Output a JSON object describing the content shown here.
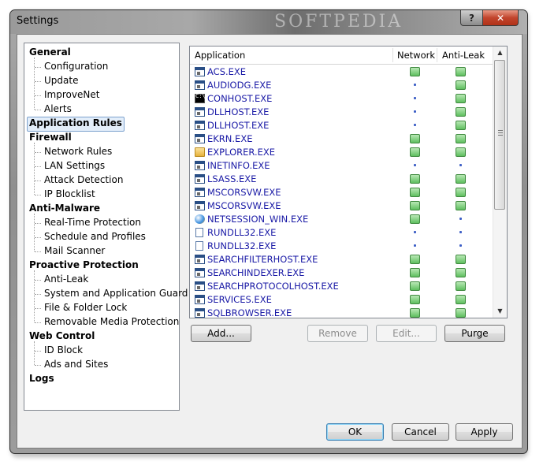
{
  "window": {
    "title": "Settings",
    "watermark": "SOFTPEDIA",
    "help_label": "?",
    "close_label": "✕"
  },
  "tree": {
    "categories": [
      {
        "label": "General",
        "children": [
          "Configuration",
          "Update",
          "ImproveNet",
          "Alerts"
        ]
      },
      {
        "label": "Application Rules",
        "selected": true,
        "children": []
      },
      {
        "label": "Firewall",
        "children": [
          "Network Rules",
          "LAN Settings",
          "Attack Detection",
          "IP Blocklist"
        ]
      },
      {
        "label": "Anti-Malware",
        "children": [
          "Real-Time Protection",
          "Schedule and Profiles",
          "Mail Scanner"
        ]
      },
      {
        "label": "Proactive Protection",
        "children": [
          "Anti-Leak",
          "System and Application Guard",
          "File & Folder Lock",
          "Removable Media Protection"
        ]
      },
      {
        "label": "Web Control",
        "children": [
          "ID Block",
          "Ads and Sites"
        ]
      },
      {
        "label": "Logs",
        "children": []
      }
    ]
  },
  "list": {
    "columns": {
      "application": "Application",
      "network": "Network",
      "antileak": "Anti-Leak"
    },
    "rows": [
      {
        "name": "ACS.EXE",
        "icon": "window-icon",
        "network": true,
        "antileak": true
      },
      {
        "name": "AUDIODG.EXE",
        "icon": "window-icon",
        "network": false,
        "antileak": true
      },
      {
        "name": "CONHOST.EXE",
        "icon": "cmd-icon",
        "network": false,
        "antileak": true
      },
      {
        "name": "DLLHOST.EXE",
        "icon": "window-icon",
        "network": false,
        "antileak": true
      },
      {
        "name": "DLLHOST.EXE",
        "icon": "window-icon",
        "network": false,
        "antileak": true
      },
      {
        "name": "EKRN.EXE",
        "icon": "window-icon",
        "network": true,
        "antileak": true
      },
      {
        "name": "EXPLORER.EXE",
        "icon": "folder-icon",
        "network": true,
        "antileak": true
      },
      {
        "name": "INETINFO.EXE",
        "icon": "window-icon",
        "network": false,
        "antileak": false
      },
      {
        "name": "LSASS.EXE",
        "icon": "window-icon",
        "network": true,
        "antileak": true
      },
      {
        "name": "MSCORSVW.EXE",
        "icon": "window-icon",
        "network": true,
        "antileak": true
      },
      {
        "name": "MSCORSVW.EXE",
        "icon": "window-icon",
        "network": true,
        "antileak": true
      },
      {
        "name": "NETSESSION_WIN.EXE",
        "icon": "netsession-icon",
        "network": true,
        "antileak": false
      },
      {
        "name": "RUNDLL32.EXE",
        "icon": "document-icon",
        "network": false,
        "antileak": false
      },
      {
        "name": "RUNDLL32.EXE",
        "icon": "document-icon",
        "network": false,
        "antileak": false
      },
      {
        "name": "SEARCHFILTERHOST.EXE",
        "icon": "window-icon",
        "network": true,
        "antileak": true
      },
      {
        "name": "SEARCHINDEXER.EXE",
        "icon": "window-icon",
        "network": true,
        "antileak": true
      },
      {
        "name": "SEARCHPROTOCOLHOST.EXE",
        "icon": "window-icon",
        "network": true,
        "antileak": true
      },
      {
        "name": "SERVICES.EXE",
        "icon": "window-icon",
        "network": true,
        "antileak": true
      },
      {
        "name": "SQLBROWSER.EXE",
        "icon": "window-icon",
        "network": true,
        "antileak": true
      }
    ]
  },
  "list_buttons": {
    "add": "Add...",
    "remove": "Remove",
    "edit": "Edit...",
    "purge": "Purge"
  },
  "dialog_buttons": {
    "ok": "OK",
    "cancel": "Cancel",
    "apply": "Apply"
  }
}
